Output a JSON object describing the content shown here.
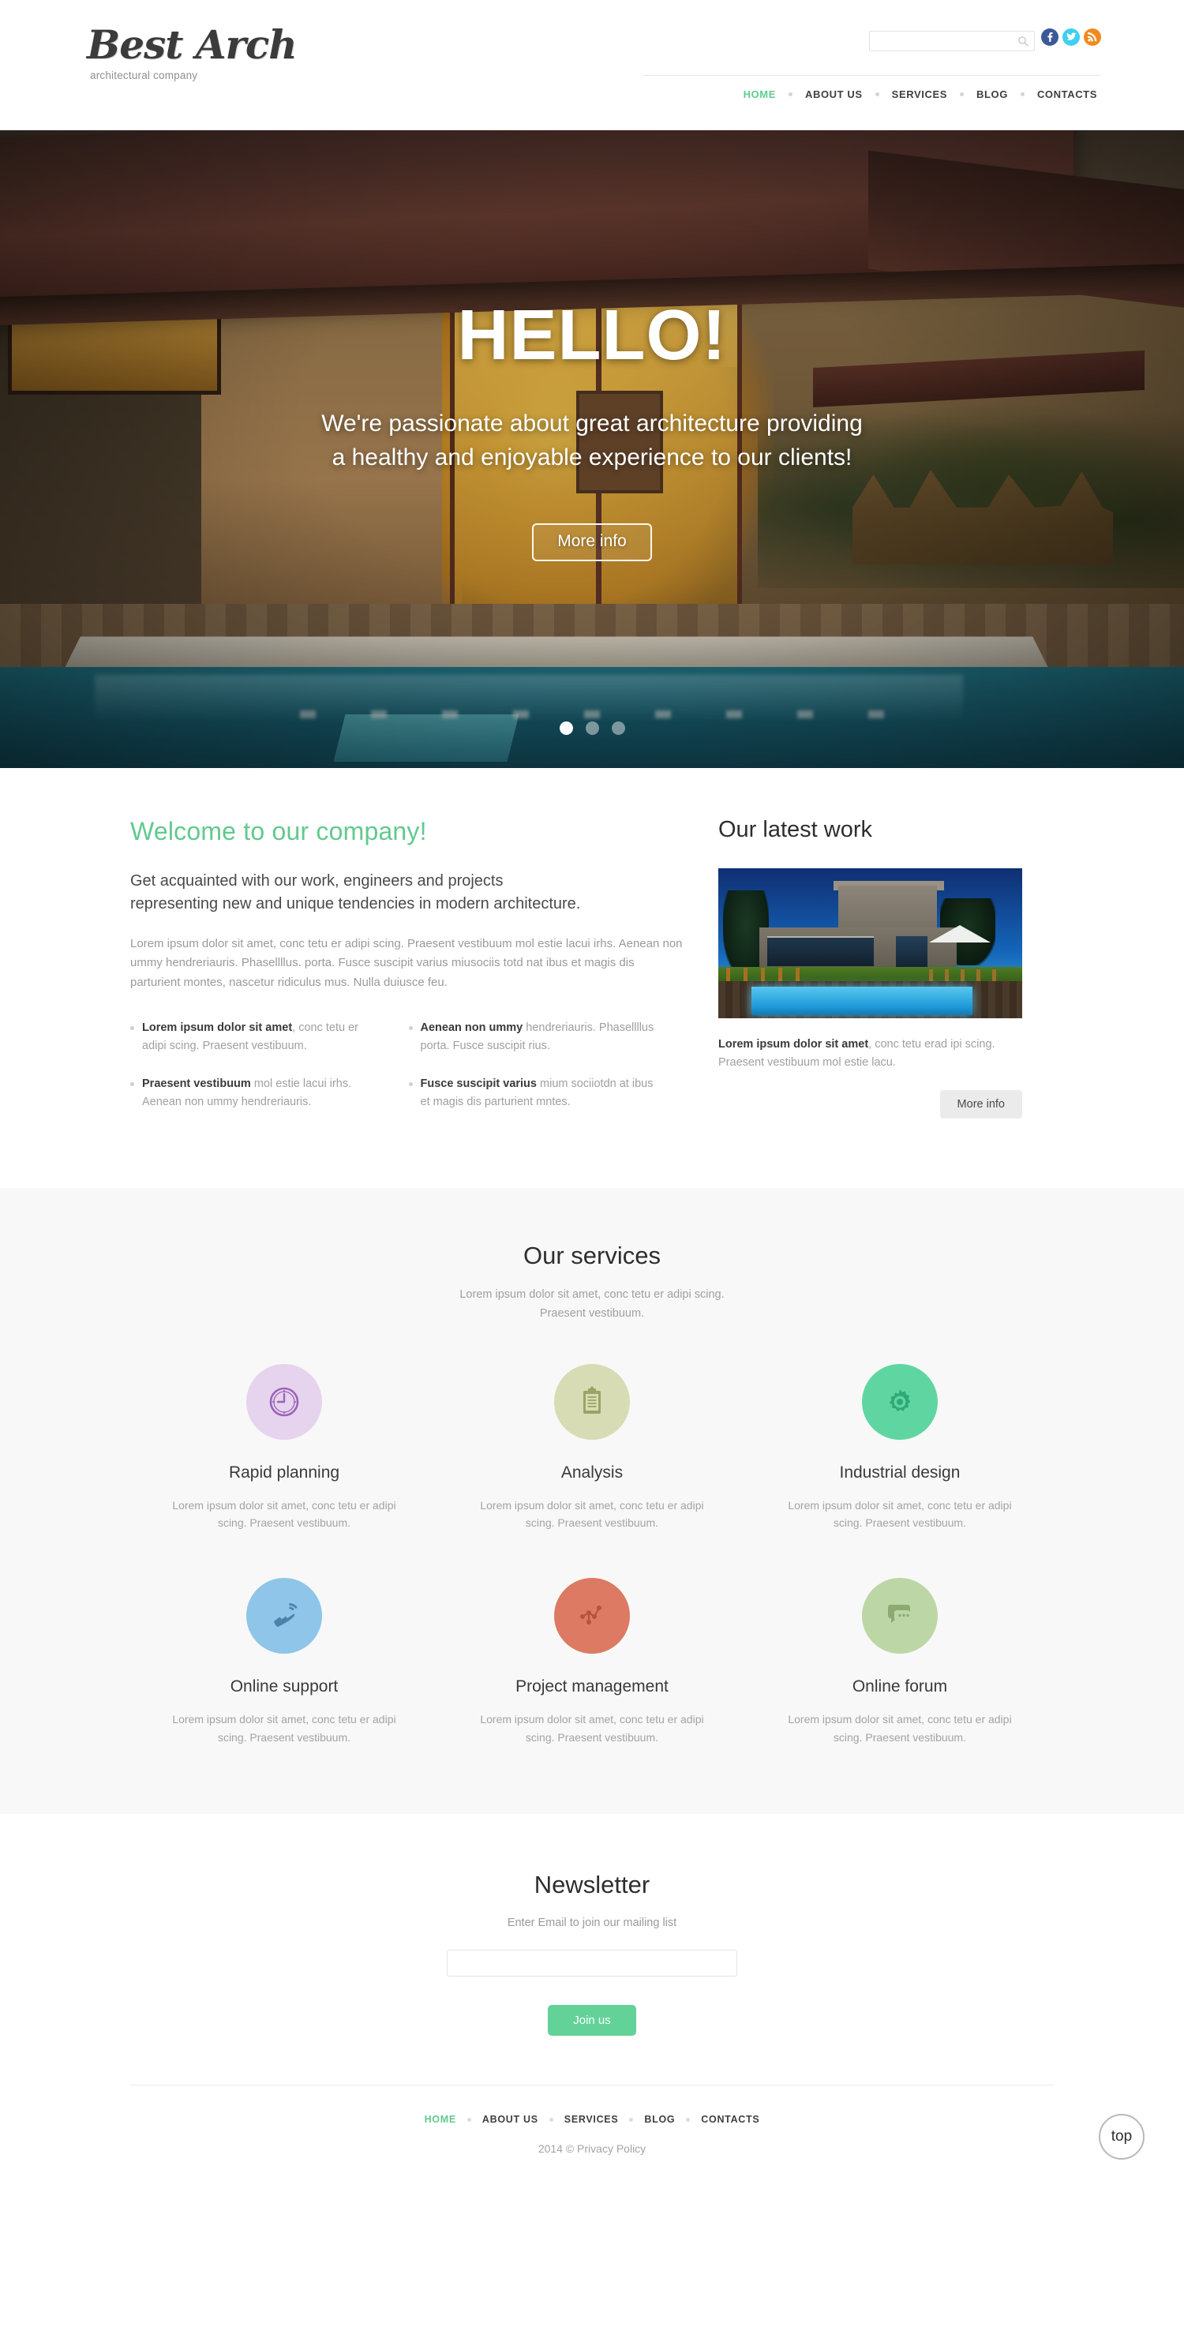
{
  "brand": {
    "name": "Best Arch",
    "tagline": "architectural company"
  },
  "colors": {
    "accent_green": "#62c98f",
    "button_green": "#63d298",
    "facebook": "#3b5998",
    "twitter": "#3ed0f0",
    "rss": "#f08a1e"
  },
  "search": {
    "value": "",
    "placeholder": "",
    "icon": "search-icon"
  },
  "socials": [
    {
      "name": "facebook-icon",
      "glyph": "f"
    },
    {
      "name": "twitter-icon",
      "glyph": "t"
    },
    {
      "name": "rss-icon",
      "glyph": "r"
    }
  ],
  "nav": {
    "items": [
      {
        "label": "HOME",
        "active": true
      },
      {
        "label": "ABOUT US",
        "active": false
      },
      {
        "label": "SERVICES",
        "active": false
      },
      {
        "label": "BLOG",
        "active": false
      },
      {
        "label": "CONTACTS",
        "active": false
      }
    ]
  },
  "hero": {
    "title": "HELLO!",
    "subtitle_line1": "We're passionate about great  architecture providing",
    "subtitle_line2": "a healthy and enjoyable experience to our clients!",
    "button_label": "More info",
    "slides_total": 3,
    "active_slide": 1
  },
  "welcome": {
    "heading": "Welcome to our company!",
    "lead_line1": "Get acquainted with our work, engineers and projects",
    "lead_line2": "representing new and unique tendencies in modern architecture.",
    "paragraph": "Lorem ipsum dolor sit amet, conc tetu er adipi scing. Praesent vestibuum mol estie lacui irhs. Aenean non ummy hendreriauris. Phasellllus. porta. Fusce suscipit varius miusociis totd nat ibus et magis dis parturient montes, nascetur ridiculus mus. Nulla duiusce feu.",
    "bullets": [
      {
        "bold": "Lorem ipsum dolor sit amet",
        "rest": ", conc tetu er adipi scing. Praesent vestibuum."
      },
      {
        "bold": "Aenean non ummy",
        "rest": " hendreriauris. Phasellllus porta. Fusce suscipit rius."
      },
      {
        "bold": "Praesent vestibuum",
        "rest": " mol estie lacui irhs. Aenean non ummy hendreriauris."
      },
      {
        "bold": "Fusce suscipit varius",
        "rest": " mium sociiotdn at ibus et magis dis parturient mntes."
      }
    ]
  },
  "latest_work": {
    "heading": "Our latest work",
    "image_name": "modern-house-pool-photo",
    "caption_bold": "Lorem ipsum dolor sit amet",
    "caption_rest": ", conc tetu erad ipi scing. Praesent vestibuum mol estie lacu.",
    "button_label": "More info"
  },
  "services": {
    "heading": "Our services",
    "subtitle_line1": "Lorem ipsum dolor sit amet, conc tetu  er adipi scing.",
    "subtitle_line2": "Praesent vestibuum.",
    "items": [
      {
        "name": "Rapid planning",
        "desc": "Lorem ipsum dolor sit amet, conc tetu er adipi scing. Praesent vestibuum.",
        "icon": "clock-icon",
        "circle_color": "#e6d4ee",
        "icon_color": "#9a64b8"
      },
      {
        "name": "Analysis",
        "desc": "Lorem ipsum dolor sit amet, conc tetu er adipi scing. Praesent vestibuum.",
        "icon": "clipboard-icon",
        "circle_color": "#d8dcb4",
        "icon_color": "#9ba366"
      },
      {
        "name": "Industrial design",
        "desc": "Lorem ipsum dolor sit amet, conc tetu er adipi scing. Praesent vestibuum.",
        "icon": "gear-icon",
        "circle_color": "#5fd6a2",
        "icon_color": "#2fa877"
      },
      {
        "name": "Online support",
        "desc": "Lorem ipsum dolor sit amet, conc tetu er adipi scing. Praesent vestibuum.",
        "icon": "phone-ringing-icon",
        "circle_color": "#8fc5e8",
        "icon_color": "#4c82a8"
      },
      {
        "name": "Project management",
        "desc": "Lorem ipsum dolor sit amet, conc tetu er adipi scing. Praesent vestibuum.",
        "icon": "network-nodes-icon",
        "circle_color": "#dd7a63",
        "icon_color": "#b4543f"
      },
      {
        "name": "Online forum",
        "desc": "Lorem ipsum dolor sit amet, conc tetu er adipi scing. Praesent vestibuum.",
        "icon": "chat-bubbles-icon",
        "circle_color": "#bdd6a6",
        "icon_color": "#8bab72"
      }
    ]
  },
  "newsletter": {
    "heading": "Newsletter",
    "subtitle": "Enter Email to join our mailing list",
    "input_value": "",
    "input_placeholder": "",
    "button_label": "Join us"
  },
  "footer": {
    "nav": [
      {
        "label": "HOME",
        "active": true
      },
      {
        "label": "ABOUT US",
        "active": false
      },
      {
        "label": "SERVICES",
        "active": false
      },
      {
        "label": "BLOG",
        "active": false
      },
      {
        "label": "CONTACTS",
        "active": false
      }
    ],
    "copyright": "2014 © Privacy Policy",
    "top_button_label": "top"
  }
}
